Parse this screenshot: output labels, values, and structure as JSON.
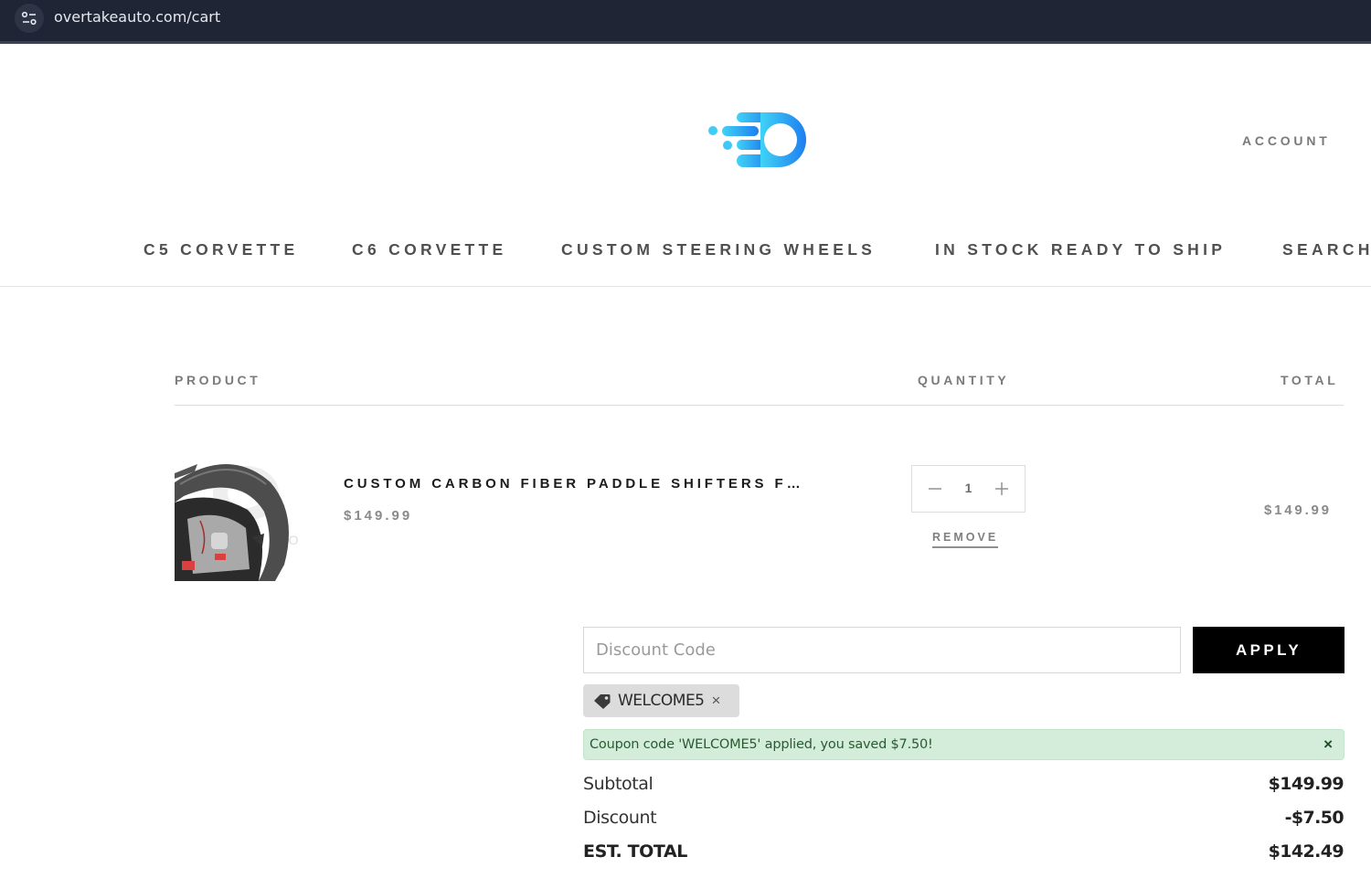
{
  "browser": {
    "url": "overtakeauto.com/cart",
    "site_info_icon": "tune-icon"
  },
  "header": {
    "logo_icon": "overtake-logo",
    "account_label": "ACCOUNT",
    "nav": [
      {
        "label": "C5 CORVETTE"
      },
      {
        "label": "C6 CORVETTE"
      },
      {
        "label": "CUSTOM STEERING WHEELS"
      },
      {
        "label": "IN STOCK READY TO SHIP"
      },
      {
        "label": "SEARCH"
      }
    ]
  },
  "cart": {
    "columns": {
      "product": "PRODUCT",
      "quantity": "QUANTITY",
      "total": "TOTAL"
    },
    "items": [
      {
        "title": "CUSTOM CARBON FIBER PADDLE SHIFTERS F…",
        "price": "$149.99",
        "quantity": "1",
        "remove_label": "REMOVE",
        "line_total": "$149.99",
        "image_watermark": "KE  TO"
      }
    ]
  },
  "discount": {
    "placeholder": "Discount Code",
    "value": "",
    "apply_label": "APPLY",
    "applied_code": "WELCOME5",
    "remove_code_label": "×",
    "alert_message": "Coupon code 'WELCOME5' applied, you saved $7.50!",
    "alert_close_label": "×"
  },
  "summary": {
    "subtotal_label": "Subtotal",
    "subtotal_value": "$149.99",
    "discount_label": "Discount",
    "discount_value": "-$7.50",
    "total_label": "EST. TOTAL",
    "total_value": "$142.49"
  },
  "colors": {
    "browser_bar": "#1f2535",
    "logo_blue": "#2196f3",
    "logo_cyan": "#3fd0f5",
    "apply_button": "#000000",
    "alert_bg": "#d4edda",
    "alert_text": "#2a5a33"
  }
}
